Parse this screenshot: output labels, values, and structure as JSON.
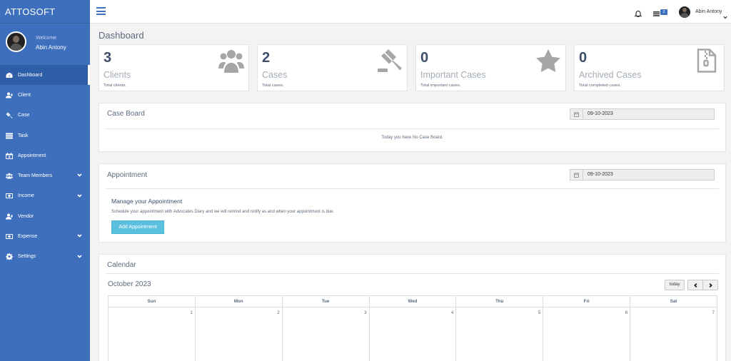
{
  "brand": "ATTOSOFT",
  "sidebar": {
    "welcome": "Welcome",
    "user_name": "Abin Antony",
    "items": [
      {
        "label": "Dashboard",
        "icon": "dashboard-icon",
        "active": true
      },
      {
        "label": "Client",
        "icon": "user-plus-icon"
      },
      {
        "label": "Case",
        "icon": "gavel-icon"
      },
      {
        "label": "Task",
        "icon": "tasks-icon"
      },
      {
        "label": "Appointment",
        "icon": "calendar-plus-icon"
      },
      {
        "label": "Team Members",
        "icon": "users-icon",
        "has_submenu": true
      },
      {
        "label": "Income",
        "icon": "money-icon",
        "has_submenu": true
      },
      {
        "label": "Vendor",
        "icon": "user-plus-icon"
      },
      {
        "label": "Expense",
        "icon": "money-icon",
        "has_submenu": true
      },
      {
        "label": "Settings",
        "icon": "gear-icon",
        "has_submenu": true
      }
    ]
  },
  "topbar": {
    "badge_count": "2",
    "user_name": "Abin Antony"
  },
  "page_title": "Dashboard",
  "stats": [
    {
      "value": "3",
      "label": "Clients",
      "desc": "Total clients.",
      "icon": "users-icon"
    },
    {
      "value": "2",
      "label": "Cases",
      "desc": "Total cases.",
      "icon": "gavel-icon"
    },
    {
      "value": "0",
      "label": "Important Cases",
      "desc": "Total important cases.",
      "icon": "star-icon"
    },
    {
      "value": "0",
      "label": "Archived Cases",
      "desc": "Total completed cases.",
      "icon": "file-archive-icon"
    }
  ],
  "case_board": {
    "title": "Case Board",
    "date": "09-10-2023",
    "empty_message": "Today you have No Case Board."
  },
  "appointment": {
    "title": "Appointment",
    "date": "09-10-2023",
    "manage_title": "Manage your Appointment",
    "manage_text": "Schedule your appointment with Advocates Diary and we will remind and notify as and when your appointment is due.",
    "add_button": "Add Appointment"
  },
  "calendar": {
    "title": "Calendar",
    "month": "October 2023",
    "today_button": "today",
    "weekdays": [
      "Sun",
      "Mon",
      "Tue",
      "Wed",
      "Thu",
      "Fri",
      "Sat"
    ],
    "first_week": [
      "1",
      "2",
      "3",
      "4",
      "5",
      "6",
      "7"
    ]
  },
  "colors": {
    "sidebar": "#3e6fbd",
    "accent_button": "#5bc0de"
  }
}
